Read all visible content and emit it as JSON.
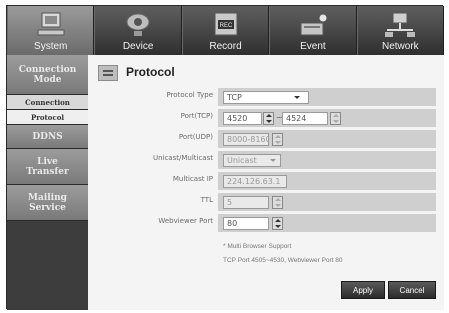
{
  "tabs": [
    {
      "label": "System",
      "icon": "system-icon",
      "active": true
    },
    {
      "label": "Device",
      "icon": "device-icon",
      "active": false
    },
    {
      "label": "Record",
      "icon": "record-icon",
      "active": false
    },
    {
      "label": "Event",
      "icon": "event-icon",
      "active": false
    },
    {
      "label": "Network",
      "icon": "network-icon",
      "active": false
    }
  ],
  "sidebar": {
    "connection_mode": "Connection Mode",
    "sub_connection": "Connection",
    "sub_protocol": "Protocol",
    "ddns": "DDNS",
    "live_transfer": "Live Transfer",
    "mailing_service": "Mailing Service"
  },
  "page": {
    "title": "Protocol",
    "title_icon": "protocol-icon"
  },
  "form": {
    "protocol_type": {
      "label": "Protocol Type",
      "value": "TCP"
    },
    "port_tcp": {
      "label": "Port(TCP)",
      "from": "4520",
      "to": "4524",
      "separator": "~"
    },
    "port_udp": {
      "label": "Port(UDP)",
      "value": "8000-8160"
    },
    "unicast_multicast": {
      "label": "Unicast/Multicast",
      "value": "Unicast"
    },
    "multicast_ip": {
      "label": "Multicast IP",
      "value": "224.126.63.1"
    },
    "ttl": {
      "label": "TTL",
      "value": "5"
    },
    "webviewer_port": {
      "label": "Webviewer Port",
      "value": "80"
    }
  },
  "notes": {
    "line1": "* Multi Browser Support",
    "line2": "TCP Port 4505~4530, Webviewer Port 80"
  },
  "buttons": {
    "apply": "Apply",
    "cancel": "Cancel"
  }
}
